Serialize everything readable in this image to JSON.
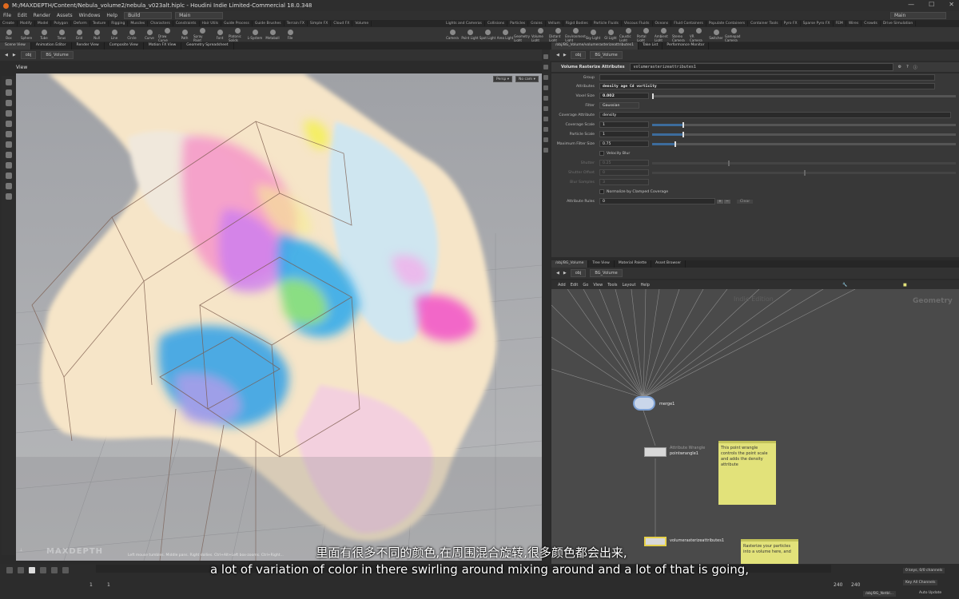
{
  "window": {
    "title": "M:/MAXDEPTH/Content/Nebula_volume2/nebula_v023alt.hiplc - Houdini Indie Limited-Commercial 18.0.348"
  },
  "menubar": {
    "items": [
      "File",
      "Edit",
      "Render",
      "Assets",
      "Windows",
      "Help"
    ],
    "build": "Build",
    "desktop": "Main",
    "right_desktop": "Main"
  },
  "shelf_tabs_left": [
    "Create",
    "Modify",
    "Model",
    "Polygon",
    "Deform",
    "Texture",
    "Rigging",
    "Muscles",
    "Characters",
    "Constraints",
    "Hair Utils",
    "Guide Process",
    "Guide Brushes",
    "Terrain FX",
    "Simple FX",
    "Cloud FX",
    "Volume"
  ],
  "shelf_tabs_right": [
    "Lights and Cameras",
    "Collisions",
    "Particles",
    "Grains",
    "Vellum",
    "Rigid Bodies",
    "Particle Fluids",
    "Viscous Fluids",
    "Oceans",
    "Fluid Containers",
    "Populate Containers",
    "Container Tools",
    "Pyro FX",
    "Sparse Pyro FX",
    "FEM",
    "Wires",
    "Crowds",
    "Drive Simulation"
  ],
  "shelf_tools_left": [
    "Box",
    "Sphere",
    "Tube",
    "Torus",
    "Grid",
    "Null",
    "Line",
    "Circle",
    "Curve",
    "Draw Curve",
    "Path",
    "Spray Paint",
    "Font",
    "Platonic Solids",
    "L-System",
    "Metaball",
    "File"
  ],
  "shelf_tools_right": [
    "Camera",
    "Point Light",
    "Spot Light",
    "Area Light",
    "Geometry Light",
    "Volume Light",
    "Distant Light",
    "Environment Light",
    "Sky Light",
    "GI Light",
    "Caustic Light",
    "Portal Light",
    "Ambient Light",
    "Stereo Camera",
    "VR Camera",
    "Switcher",
    "Gamepad Camera"
  ],
  "left_pane": {
    "tabs": [
      "Scene View",
      "Animation Editor",
      "Render View",
      "Composite View",
      "Motion FX View",
      "Geometry Spreadsheet"
    ],
    "path_obj": "obj",
    "path_node": "BG_Volume",
    "view_label": "View",
    "cam_persp": "Persp ▾",
    "cam_nocam": "No cam ▾",
    "hint": "Left mouse tumbles. Middle pans. Right dollies. Ctrl+Alt+Left box-zooms. Ctrl+Right...",
    "watermark": "MAXDEPTH"
  },
  "param_pane": {
    "tabs": [
      "/obj/BG_Volume/volumerasterizeattributes1",
      "Take List",
      "Performance Monitor"
    ],
    "path_obj": "obj",
    "path_node": "BG_Volume",
    "node_type": "Volume Rasterize Attributes",
    "node_name": "volumerasterizeattributes1",
    "rows": [
      {
        "label": "Group",
        "value": ""
      },
      {
        "label": "Attributes",
        "value": "density age Cd vorticity"
      },
      {
        "label": "Voxel Size",
        "value": "0.002"
      },
      {
        "label": "Filter",
        "value": "Gaussian"
      },
      {
        "label": "Coverage Attribute",
        "value": "density"
      },
      {
        "label": "Coverage Scale",
        "value": "1"
      },
      {
        "label": "Particle Scale",
        "value": "1"
      },
      {
        "label": "Maximum Filter Size",
        "value": "0.75"
      },
      {
        "label": "",
        "value": "Velocity Blur"
      },
      {
        "label": "Shutter",
        "value": "0.25"
      },
      {
        "label": "Shutter Offset",
        "value": "0"
      },
      {
        "label": "Blur Samples",
        "value": "3"
      },
      {
        "label": "",
        "value": "Normalize by Clamped Coverage"
      },
      {
        "label": "Attribute Rules",
        "value": "0"
      }
    ],
    "clear_label": "Clear"
  },
  "network_pane": {
    "tabs": [
      "/obj/BG_Volume",
      "Tree View",
      "Material Palette",
      "Asset Browser"
    ],
    "path_obj": "obj",
    "path_node": "BG_Volume",
    "menu": [
      "Add",
      "Edit",
      "Go",
      "View",
      "Tools",
      "Layout",
      "Help"
    ],
    "watermark_edition": "Indie Edition",
    "context_label": "Geometry",
    "nodes": {
      "merge": "merge1",
      "wrangle_type": "Attribute Wrangle",
      "wrangle": "pointwrangle1",
      "rasterize": "volumerasterizeattributes1"
    },
    "sticky1": "This point wrangle controls the point scale and adds the density attribute",
    "sticky2": "Rasterize your particles into a volume here, and"
  },
  "playbar": {
    "frame": "1",
    "start": "1",
    "start2": "1",
    "end": "240",
    "end2": "240",
    "keys": "0 keys, 0/0 channels",
    "key_all": "Key All Channels",
    "auto_update": "Auto Update",
    "path": "/obj/BG_Netbl..."
  },
  "subtitles": {
    "cn": "里面有很多不同的颜色,在周围混合旋转,很多颜色都会出来,",
    "en": "a lot of variation of color in there swirling around mixing around and a lot of that is going,"
  }
}
